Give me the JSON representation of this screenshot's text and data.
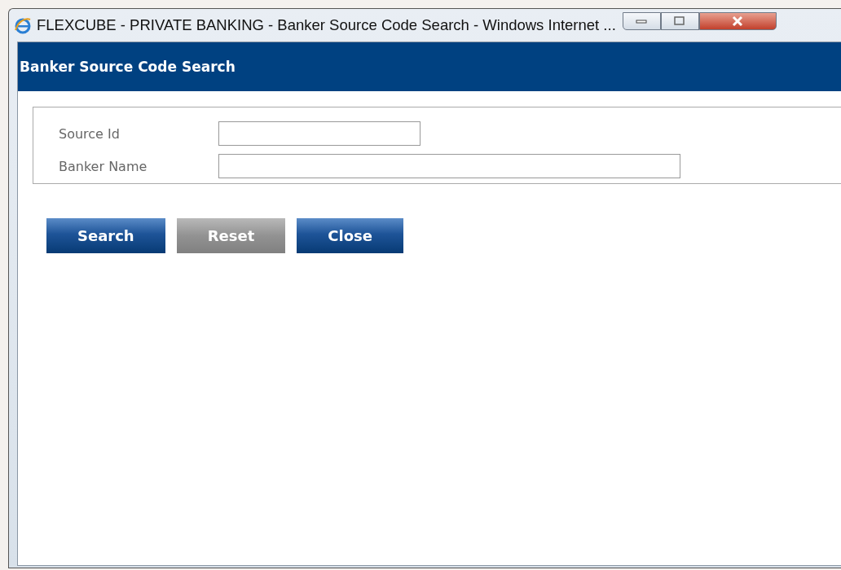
{
  "window": {
    "title": "FLEXCUBE - PRIVATE BANKING - Banker Source Code Search - Windows Internet ..."
  },
  "header": {
    "title": "Banker Source Code Search"
  },
  "fields": [
    {
      "label": "Source Id",
      "kind": "short"
    },
    {
      "label": "Banker Name",
      "kind": "long"
    }
  ],
  "buttons": [
    {
      "label": "Search",
      "disabled": false
    },
    {
      "label": "Reset",
      "disabled": true
    },
    {
      "label": "Close",
      "disabled": false
    }
  ]
}
